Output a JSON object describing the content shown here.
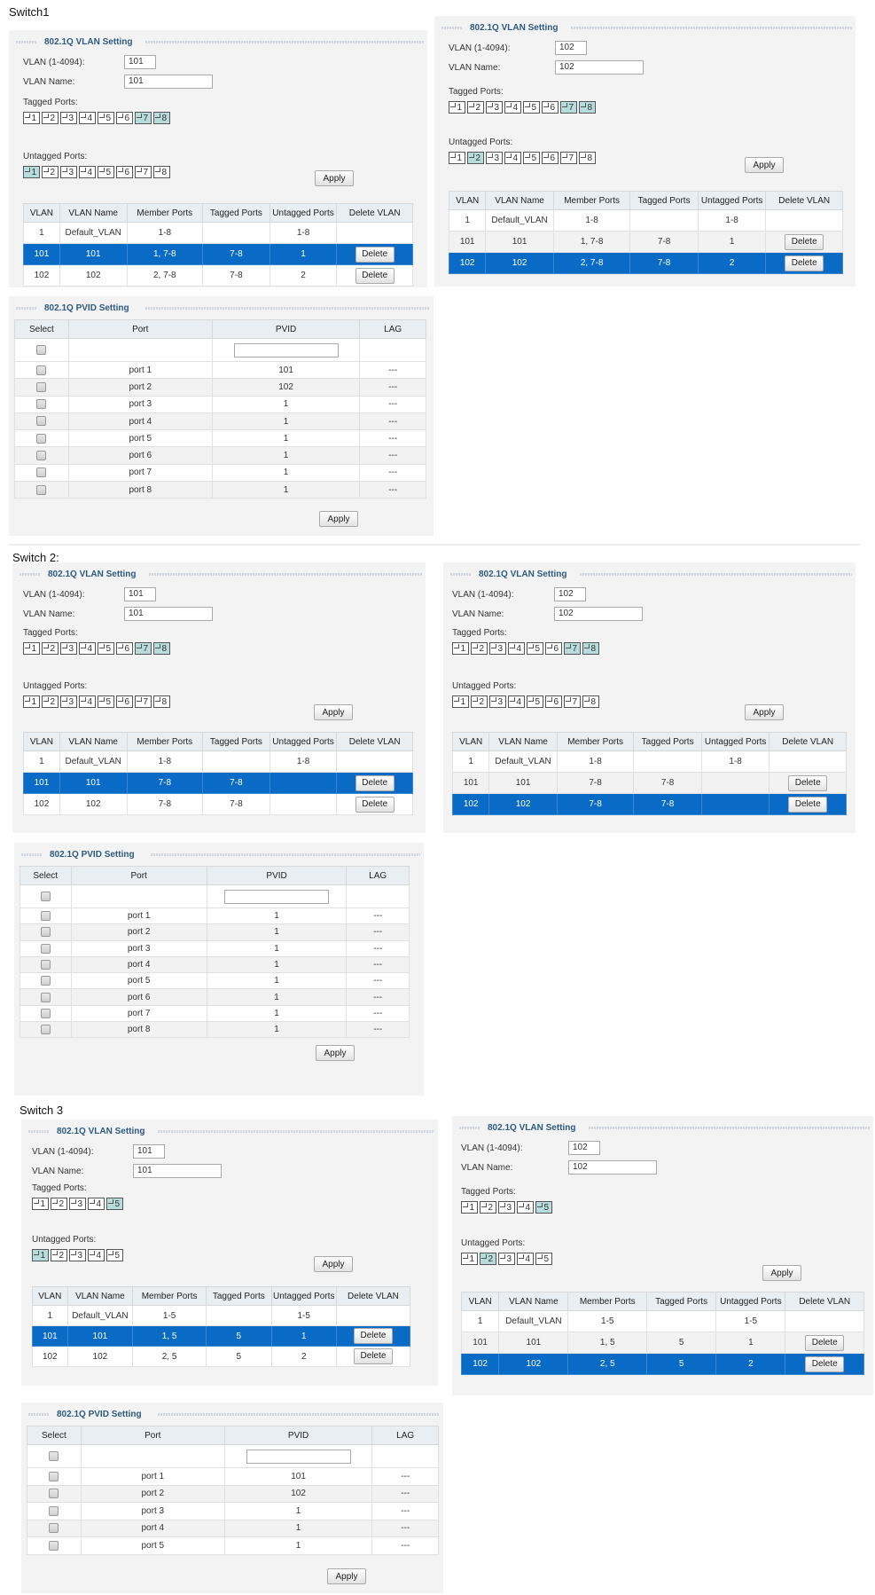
{
  "switch1": {
    "title": "Switch1",
    "left": {
      "panel_title": "802.1Q VLAN Setting",
      "vlan_id_label": "VLAN (1-4094):",
      "vlan_id_value": "101",
      "vlan_name_label": "VLAN Name:",
      "vlan_name_value": "101",
      "tagged_label": "Tagged Ports:",
      "untagged_label": "Untagged Ports:",
      "ports": [
        "1",
        "2",
        "3",
        "4",
        "5",
        "6",
        "7",
        "8"
      ],
      "tagged_selected": [
        "7",
        "8"
      ],
      "untagged_selected": [
        "1"
      ],
      "apply_label": "Apply",
      "table": {
        "headers": [
          "VLAN",
          "VLAN Name",
          "Member Ports",
          "Tagged Ports",
          "Untagged Ports",
          "Delete VLAN"
        ],
        "rows": [
          {
            "vlan": "1",
            "name": "Default_VLAN",
            "member": "1-8",
            "tagged": "",
            "untagged": "1-8",
            "delete": ""
          },
          {
            "vlan": "101",
            "name": "101",
            "member": "1, 7-8",
            "tagged": "7-8",
            "untagged": "1",
            "delete": "Delete"
          },
          {
            "vlan": "102",
            "name": "102",
            "member": "2, 7-8",
            "tagged": "7-8",
            "untagged": "2",
            "delete": "Delete"
          }
        ],
        "selected_row": 1
      }
    },
    "right": {
      "panel_title": "802.1Q VLAN Setting",
      "vlan_id_label": "VLAN (1-4094):",
      "vlan_id_value": "102",
      "vlan_name_label": "VLAN Name:",
      "vlan_name_value": "102",
      "tagged_label": "Tagged Ports:",
      "untagged_label": "Untagged Ports:",
      "ports": [
        "1",
        "2",
        "3",
        "4",
        "5",
        "6",
        "7",
        "8"
      ],
      "tagged_selected": [
        "7",
        "8"
      ],
      "untagged_selected": [
        "2"
      ],
      "apply_label": "Apply",
      "table": {
        "headers": [
          "VLAN",
          "VLAN Name",
          "Member Ports",
          "Tagged Ports",
          "Untagged Ports",
          "Delete VLAN"
        ],
        "rows": [
          {
            "vlan": "1",
            "name": "Default_VLAN",
            "member": "1-8",
            "tagged": "",
            "untagged": "1-8",
            "delete": ""
          },
          {
            "vlan": "101",
            "name": "101",
            "member": "1, 7-8",
            "tagged": "7-8",
            "untagged": "1",
            "delete": "Delete"
          },
          {
            "vlan": "102",
            "name": "102",
            "member": "2, 7-8",
            "tagged": "7-8",
            "untagged": "2",
            "delete": "Delete"
          }
        ],
        "selected_row": 2
      }
    },
    "pvid": {
      "panel_title": "802.1Q PVID Setting",
      "headers": [
        "Select",
        "Port",
        "PVID",
        "LAG"
      ],
      "rows": [
        {
          "port": "port 1",
          "pvid": "101",
          "lag": "---"
        },
        {
          "port": "port 2",
          "pvid": "102",
          "lag": "---"
        },
        {
          "port": "port 3",
          "pvid": "1",
          "lag": "---"
        },
        {
          "port": "port 4",
          "pvid": "1",
          "lag": "---"
        },
        {
          "port": "port 5",
          "pvid": "1",
          "lag": "---"
        },
        {
          "port": "port 6",
          "pvid": "1",
          "lag": "---"
        },
        {
          "port": "port 7",
          "pvid": "1",
          "lag": "---"
        },
        {
          "port": "port 8",
          "pvid": "1",
          "lag": "---"
        }
      ],
      "apply_label": "Apply"
    }
  },
  "switch2": {
    "title": "Switch 2:",
    "left": {
      "panel_title": "802.1Q VLAN Setting",
      "vlan_id_label": "VLAN (1-4094):",
      "vlan_id_value": "101",
      "vlan_name_label": "VLAN Name:",
      "vlan_name_value": "101",
      "tagged_label": "Tagged Ports:",
      "untagged_label": "Untagged Ports:",
      "ports": [
        "1",
        "2",
        "3",
        "4",
        "5",
        "6",
        "7",
        "8"
      ],
      "tagged_selected": [
        "7",
        "8"
      ],
      "untagged_selected": [],
      "apply_label": "Apply",
      "table": {
        "headers": [
          "VLAN",
          "VLAN Name",
          "Member Ports",
          "Tagged Ports",
          "Untagged Ports",
          "Delete VLAN"
        ],
        "rows": [
          {
            "vlan": "1",
            "name": "Default_VLAN",
            "member": "1-8",
            "tagged": "",
            "untagged": "1-8",
            "delete": ""
          },
          {
            "vlan": "101",
            "name": "101",
            "member": "7-8",
            "tagged": "7-8",
            "untagged": "",
            "delete": "Delete"
          },
          {
            "vlan": "102",
            "name": "102",
            "member": "7-8",
            "tagged": "7-8",
            "untagged": "",
            "delete": "Delete"
          }
        ],
        "selected_row": 1
      }
    },
    "right": {
      "panel_title": "802.1Q VLAN Setting",
      "vlan_id_label": "VLAN (1-4094):",
      "vlan_id_value": "102",
      "vlan_name_label": "VLAN Name:",
      "vlan_name_value": "102",
      "tagged_label": "Tagged Ports:",
      "untagged_label": "Untagged Ports:",
      "ports": [
        "1",
        "2",
        "3",
        "4",
        "5",
        "6",
        "7",
        "8"
      ],
      "tagged_selected": [
        "7",
        "8"
      ],
      "untagged_selected": [],
      "apply_label": "Apply",
      "table": {
        "headers": [
          "VLAN",
          "VLAN Name",
          "Member Ports",
          "Tagged Ports",
          "Untagged Ports",
          "Delete VLAN"
        ],
        "rows": [
          {
            "vlan": "1",
            "name": "Default_VLAN",
            "member": "1-8",
            "tagged": "",
            "untagged": "1-8",
            "delete": ""
          },
          {
            "vlan": "101",
            "name": "101",
            "member": "7-8",
            "tagged": "7-8",
            "untagged": "",
            "delete": "Delete"
          },
          {
            "vlan": "102",
            "name": "102",
            "member": "7-8",
            "tagged": "7-8",
            "untagged": "",
            "delete": "Delete"
          }
        ],
        "selected_row": 2
      }
    },
    "pvid": {
      "panel_title": "802.1Q PVID Setting",
      "headers": [
        "Select",
        "Port",
        "PVID",
        "LAG"
      ],
      "rows": [
        {
          "port": "port 1",
          "pvid": "1",
          "lag": "---"
        },
        {
          "port": "port 2",
          "pvid": "1",
          "lag": "---"
        },
        {
          "port": "port 3",
          "pvid": "1",
          "lag": "---"
        },
        {
          "port": "port 4",
          "pvid": "1",
          "lag": "---"
        },
        {
          "port": "port 5",
          "pvid": "1",
          "lag": "---"
        },
        {
          "port": "port 6",
          "pvid": "1",
          "lag": "---"
        },
        {
          "port": "port 7",
          "pvid": "1",
          "lag": "---"
        },
        {
          "port": "port 8",
          "pvid": "1",
          "lag": "---"
        }
      ],
      "apply_label": "Apply"
    }
  },
  "switch3": {
    "title": "Switch 3",
    "left": {
      "panel_title": "802.1Q VLAN Setting",
      "vlan_id_label": "VLAN (1-4094):",
      "vlan_id_value": "101",
      "vlan_name_label": "VLAN Name:",
      "vlan_name_value": "101",
      "tagged_label": "Tagged Ports:",
      "untagged_label": "Untagged Ports:",
      "ports": [
        "1",
        "2",
        "3",
        "4",
        "5"
      ],
      "tagged_selected": [
        "5"
      ],
      "untagged_selected": [
        "1"
      ],
      "apply_label": "Apply",
      "table": {
        "headers": [
          "VLAN",
          "VLAN Name",
          "Member Ports",
          "Tagged Ports",
          "Untagged Ports",
          "Delete VLAN"
        ],
        "rows": [
          {
            "vlan": "1",
            "name": "Default_VLAN",
            "member": "1-5",
            "tagged": "",
            "untagged": "1-5",
            "delete": ""
          },
          {
            "vlan": "101",
            "name": "101",
            "member": "1, 5",
            "tagged": "5",
            "untagged": "1",
            "delete": "Delete"
          },
          {
            "vlan": "102",
            "name": "102",
            "member": "2, 5",
            "tagged": "5",
            "untagged": "2",
            "delete": "Delete"
          }
        ],
        "selected_row": 1
      }
    },
    "right": {
      "panel_title": "802.1Q VLAN Setting",
      "vlan_id_label": "VLAN (1-4094):",
      "vlan_id_value": "102",
      "vlan_name_label": "VLAN Name:",
      "vlan_name_value": "102",
      "tagged_label": "Tagged Ports:",
      "untagged_label": "Untagged Ports:",
      "ports": [
        "1",
        "2",
        "3",
        "4",
        "5"
      ],
      "tagged_selected": [
        "5"
      ],
      "untagged_selected": [
        "2"
      ],
      "apply_label": "Apply",
      "table": {
        "headers": [
          "VLAN",
          "VLAN Name",
          "Member Ports",
          "Tagged Ports",
          "Untagged Ports",
          "Delete VLAN"
        ],
        "rows": [
          {
            "vlan": "1",
            "name": "Default_VLAN",
            "member": "1-5",
            "tagged": "",
            "untagged": "1-5",
            "delete": ""
          },
          {
            "vlan": "101",
            "name": "101",
            "member": "1, 5",
            "tagged": "5",
            "untagged": "1",
            "delete": "Delete"
          },
          {
            "vlan": "102",
            "name": "102",
            "member": "2, 5",
            "tagged": "5",
            "untagged": "2",
            "delete": "Delete"
          }
        ],
        "selected_row": 2
      }
    },
    "pvid": {
      "panel_title": "802.1Q PVID Setting",
      "headers": [
        "Select",
        "Port",
        "PVID",
        "LAG"
      ],
      "rows": [
        {
          "port": "port 1",
          "pvid": "101",
          "lag": "---"
        },
        {
          "port": "port 2",
          "pvid": "102",
          "lag": "---"
        },
        {
          "port": "port 3",
          "pvid": "1",
          "lag": "---"
        },
        {
          "port": "port 4",
          "pvid": "1",
          "lag": "---"
        },
        {
          "port": "port 5",
          "pvid": "1",
          "lag": "---"
        }
      ],
      "apply_label": "Apply"
    }
  }
}
